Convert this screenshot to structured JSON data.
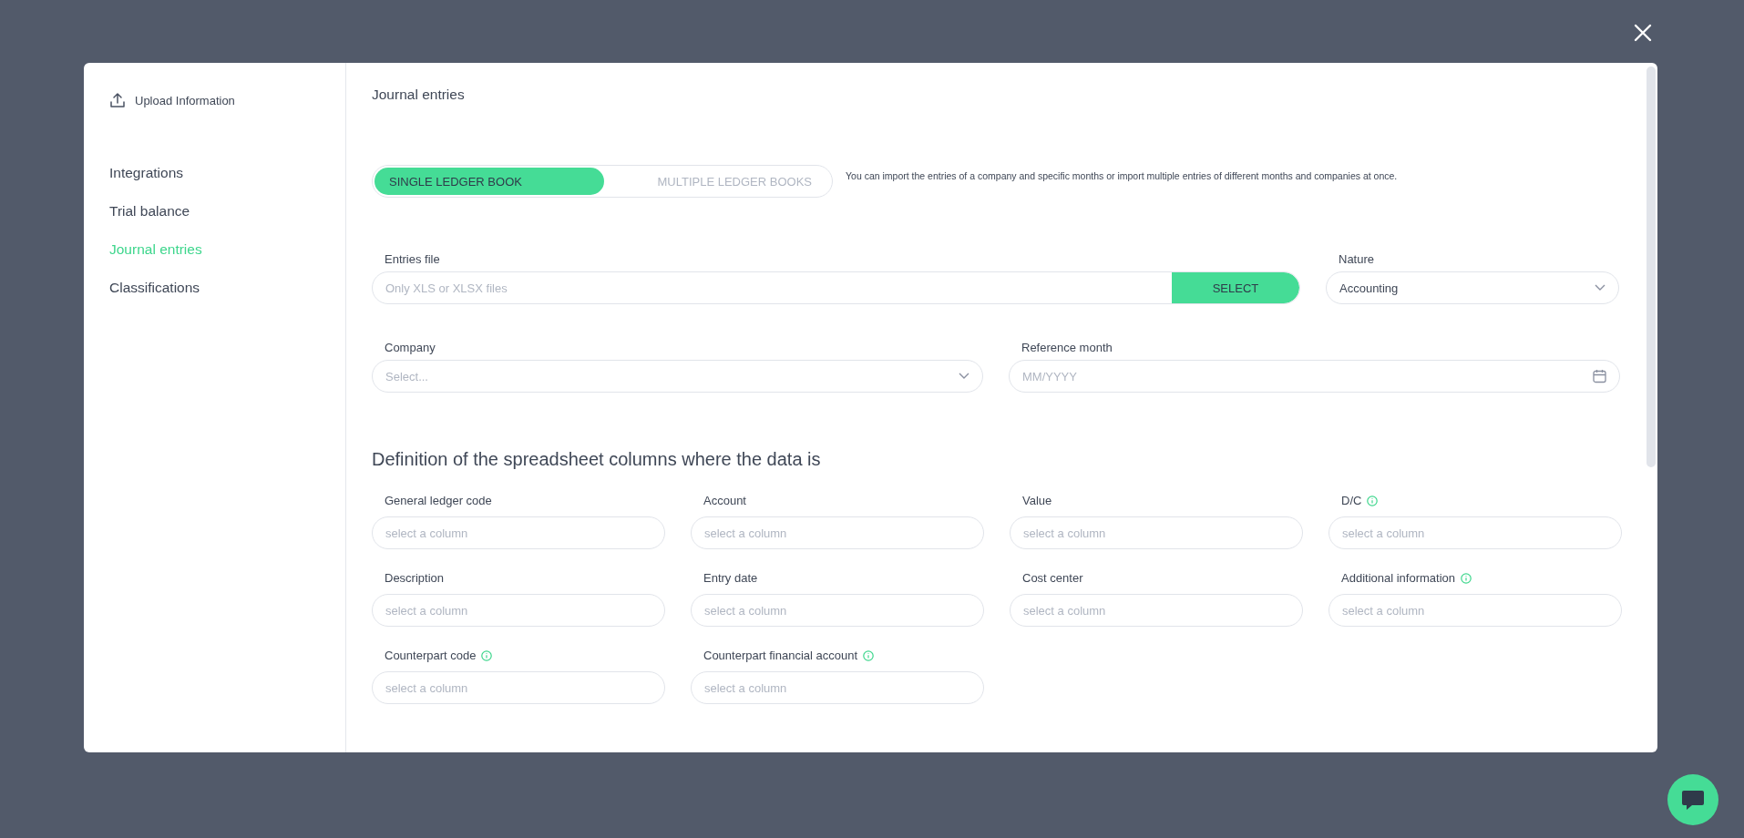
{
  "sidebar": {
    "upload_label": "Upload Information",
    "items": [
      {
        "label": "Integrations",
        "selected": false
      },
      {
        "label": "Trial balance",
        "selected": false
      },
      {
        "label": "Journal entries",
        "selected": true
      },
      {
        "label": "Classifications",
        "selected": false
      }
    ]
  },
  "content": {
    "title": "Journal entries",
    "mode_toggle": {
      "options": [
        {
          "label": "SINGLE LEDGER BOOK",
          "selected": true
        },
        {
          "label": "MULTIPLE LEDGER BOOKS",
          "selected": false
        }
      ],
      "help": "You can import the entries of a company and specific months or import multiple entries of different months and companies at once."
    },
    "entries_file": {
      "label": "Entries file",
      "placeholder": "Only XLS or XLSX files",
      "button": "SELECT"
    },
    "nature": {
      "label": "Nature",
      "value": "Accounting"
    },
    "company": {
      "label": "Company",
      "placeholder": "Select..."
    },
    "reference_month": {
      "label": "Reference month",
      "placeholder": "MM/YYYY"
    },
    "section_title": "Definition of the spreadsheet columns where the data is",
    "column_fields": [
      {
        "label": "General ledger code",
        "placeholder": "select a column",
        "info": false
      },
      {
        "label": "Account",
        "placeholder": "select a column",
        "info": false
      },
      {
        "label": "Value",
        "placeholder": "select a column",
        "info": false
      },
      {
        "label": "D/C",
        "placeholder": "select a column",
        "info": true
      },
      {
        "label": "Description",
        "placeholder": "select a column",
        "info": false
      },
      {
        "label": "Entry date",
        "placeholder": "select a column",
        "info": false
      },
      {
        "label": "Cost center",
        "placeholder": "select a column",
        "info": false
      },
      {
        "label": "Additional information",
        "placeholder": "select a column",
        "info": true
      },
      {
        "label": "Counterpart code",
        "placeholder": "select a column",
        "info": true
      },
      {
        "label": "Counterpart financial account",
        "placeholder": "select a column",
        "info": true
      }
    ]
  }
}
